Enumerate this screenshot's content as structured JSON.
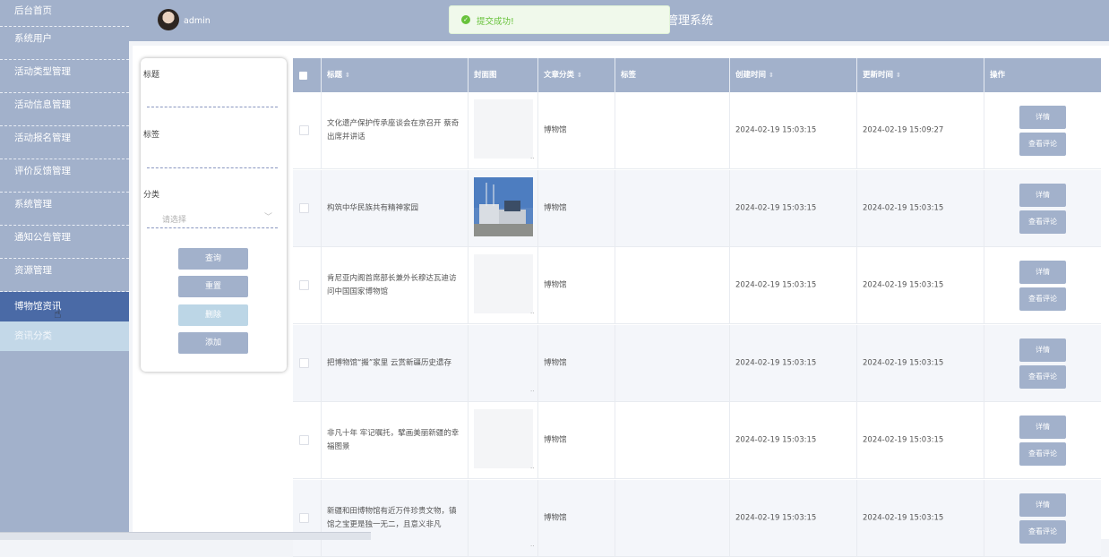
{
  "header": {
    "admin_name": "admin",
    "system_title": "管理系统"
  },
  "toast": {
    "icon": "check-circle-icon",
    "message": "提交成功!"
  },
  "sidebar": {
    "items": [
      {
        "label": "后台首页"
      },
      {
        "label": "系统用户"
      },
      {
        "label": "活动类型管理"
      },
      {
        "label": "活动信息管理"
      },
      {
        "label": "活动报名管理"
      },
      {
        "label": "评价反馈管理"
      },
      {
        "label": "系统管理"
      },
      {
        "label": "通知公告管理"
      },
      {
        "label": "资源管理"
      },
      {
        "label": "博物馆资讯"
      },
      {
        "label": "资讯分类"
      }
    ]
  },
  "search": {
    "title_label": "标题",
    "tag_label": "标签",
    "category_label": "分类",
    "category_placeholder": "请选择",
    "query_btn": "查询",
    "reset_btn": "重置",
    "delete_btn": "删除",
    "add_btn": "添加"
  },
  "table": {
    "headers": {
      "title": "标题",
      "cover": "封面图",
      "category": "文章分类",
      "tags": "标签",
      "created": "创建时间",
      "updated": "更新时间",
      "actions": "操作"
    },
    "detail_btn": "详情",
    "comments_btn": "查看评论",
    "rows": [
      {
        "title": "文化遗产保护传承座谈会在京召开 蔡奇出席并讲话",
        "category": "博物馆",
        "tags": "",
        "created": "2024-02-19 15:03:15",
        "updated": "2024-02-19 15:09:27",
        "cover": "placeholder"
      },
      {
        "title": "构筑中华民族共有精神家园",
        "category": "博物馆",
        "tags": "",
        "created": "2024-02-19 15:03:15",
        "updated": "2024-02-19 15:03:15",
        "cover": "photo"
      },
      {
        "title": "肯尼亚内阁首席部长兼外长穆达瓦迪访问中国国家博物馆",
        "category": "博物馆",
        "tags": "",
        "created": "2024-02-19 15:03:15",
        "updated": "2024-02-19 15:03:15",
        "cover": "placeholder"
      },
      {
        "title": "把博物馆“搬”家里 云赏新疆历史遗存",
        "category": "博物馆",
        "tags": "",
        "created": "2024-02-19 15:03:15",
        "updated": "2024-02-19 15:03:15",
        "cover": "none"
      },
      {
        "title": "非凡十年 牢记嘱托，擘画美丽新疆的幸福图景",
        "category": "博物馆",
        "tags": "",
        "created": "2024-02-19 15:03:15",
        "updated": "2024-02-19 15:03:15",
        "cover": "placeholder"
      },
      {
        "title": "新疆和田博物馆有近万件珍贵文物，镇馆之宝更是独一无二，且意义非凡",
        "category": "博物馆",
        "tags": "",
        "created": "2024-02-19 15:03:15",
        "updated": "2024-02-19 15:03:15",
        "cover": "none"
      }
    ]
  },
  "colors": {
    "primary": "#a2b1cb",
    "active_nav": "#4a6aa6",
    "sub_nav": "#c3d8e8",
    "success": "#67c23a"
  }
}
